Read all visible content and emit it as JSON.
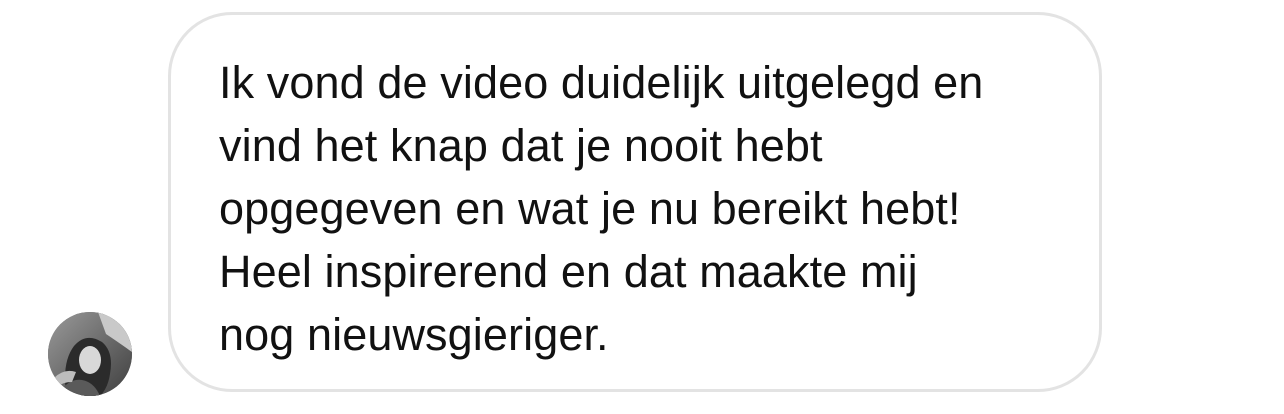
{
  "message": {
    "lines": [
      "Ik vond de video duidelijk uitgelegd en",
      "vind het knap dat je nooit hebt",
      "opgegeven en wat je nu bereikt hebt!",
      "Heel inspirerend en dat maakte mij",
      "nog nieuwsgieriger."
    ]
  },
  "sender": {
    "avatar": "profile-photo"
  },
  "colors": {
    "bubble_border": "#e3e3e3",
    "text": "#111111",
    "background": "#ffffff"
  }
}
